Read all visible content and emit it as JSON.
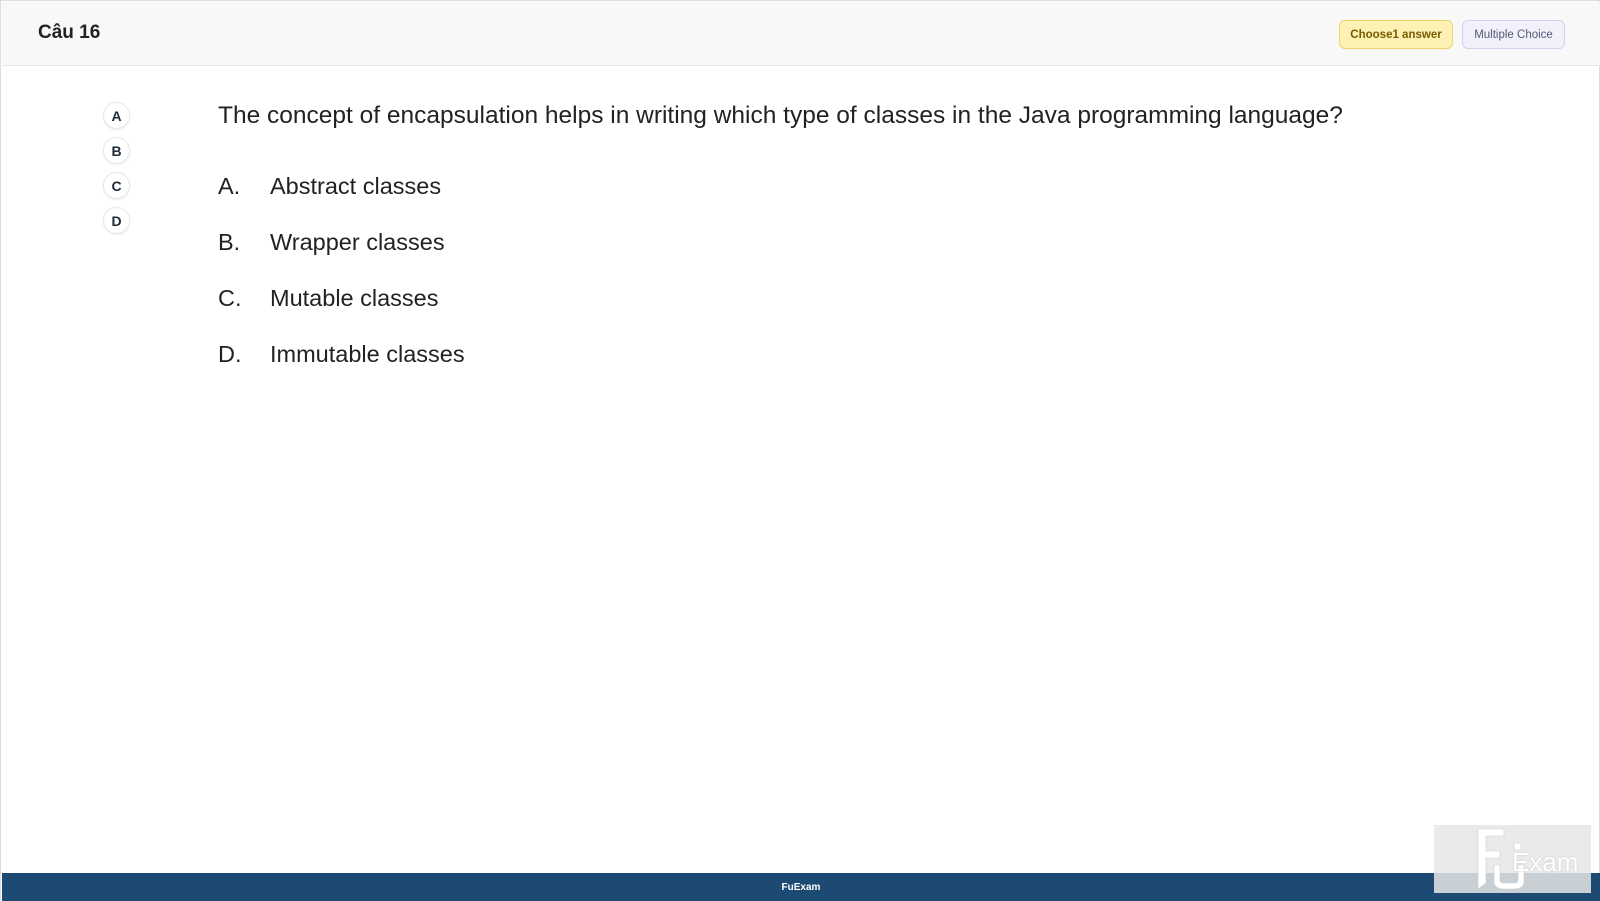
{
  "header": {
    "question_number": "Câu 16",
    "badge_choose": "Choose1 answer",
    "badge_type": "Multiple Choice"
  },
  "answer_bubbles": [
    "A",
    "B",
    "C",
    "D"
  ],
  "question": {
    "text": "The concept of encapsulation helps in writing which type of classes in the Java programming language?",
    "options": [
      {
        "letter": "A.",
        "text": "Abstract classes"
      },
      {
        "letter": "B.",
        "text": "Wrapper classes"
      },
      {
        "letter": "C.",
        "text": "Mutable classes"
      },
      {
        "letter": "D.",
        "text": "Immutable classes"
      }
    ]
  },
  "footer": {
    "brand": "FuExam"
  },
  "watermark": {
    "word": "Exam",
    "icon": "fu-logo-icon"
  },
  "colors": {
    "footer_bg": "#1d4a73",
    "badge_choose_bg": "#fdf1b4",
    "badge_type_bg": "#f1f0fb"
  }
}
